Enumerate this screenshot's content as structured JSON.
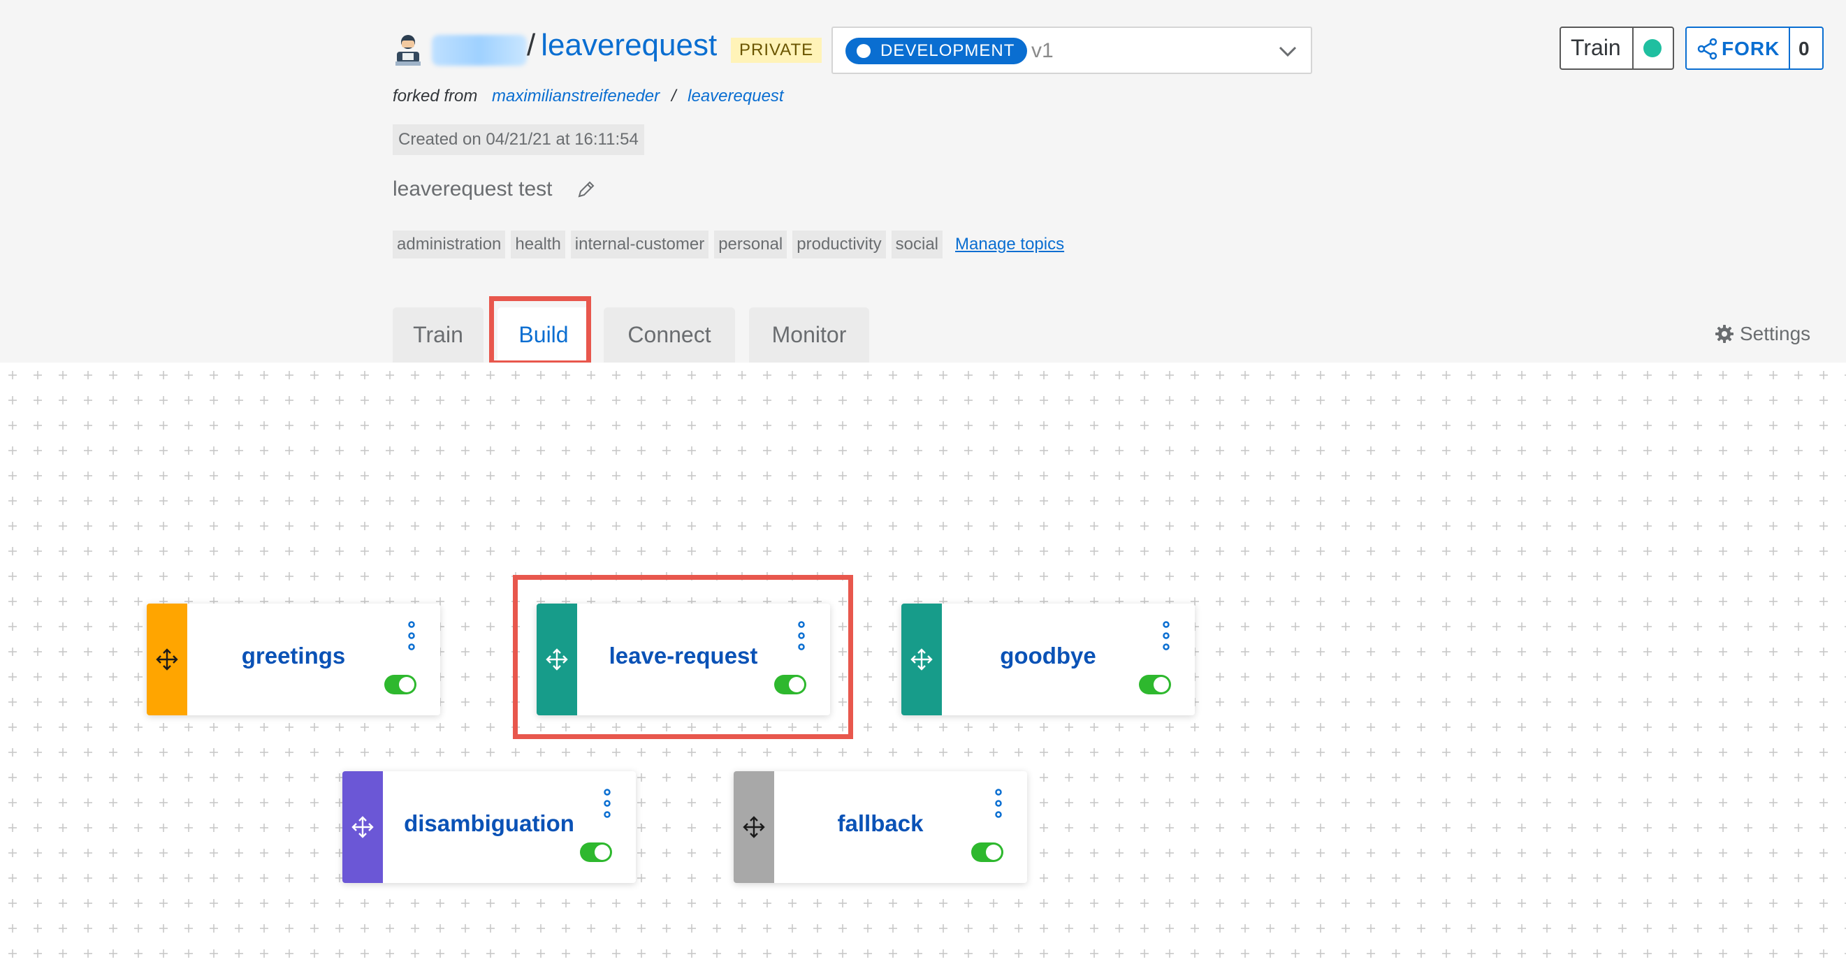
{
  "header": {
    "owner_blurred": "",
    "separator": "/",
    "bot_name": "leaverequest",
    "visibility_badge": "PRIVATE",
    "environment": {
      "label": "DEVELOPMENT",
      "version": "v1"
    },
    "train_button": {
      "label": "Train",
      "status_color": "#1fbfa0"
    },
    "fork_button": {
      "label": "FORK",
      "count": "0"
    },
    "forked_from": {
      "prefix": "forked from",
      "owner": "maximilianstreifeneder",
      "separator": "/",
      "repo": "leaverequest"
    },
    "created": "Created on 04/21/21 at 16:11:54",
    "description": "leaverequest test",
    "topics": [
      "administration",
      "health",
      "internal-customer",
      "personal",
      "productivity",
      "social"
    ],
    "manage_topics_label": "Manage topics"
  },
  "tabs": [
    {
      "label": "Train",
      "active": false
    },
    {
      "label": "Build",
      "active": true
    },
    {
      "label": "Connect",
      "active": false
    },
    {
      "label": "Monitor",
      "active": false
    }
  ],
  "settings_label": "Settings",
  "skills": [
    {
      "name": "greetings",
      "color": "#ffa500",
      "enabled": true
    },
    {
      "name": "leave-request",
      "color": "#179c8a",
      "enabled": true
    },
    {
      "name": "goodbye",
      "color": "#179c8a",
      "enabled": true
    },
    {
      "name": "disambiguation",
      "color": "#6b57d6",
      "enabled": true
    },
    {
      "name": "fallback",
      "color": "#a8a8a8",
      "enabled": true
    }
  ],
  "colors": {
    "accent": "#0a6ed1",
    "highlight": "#e8574d",
    "toggle_on": "#2eb82e"
  }
}
